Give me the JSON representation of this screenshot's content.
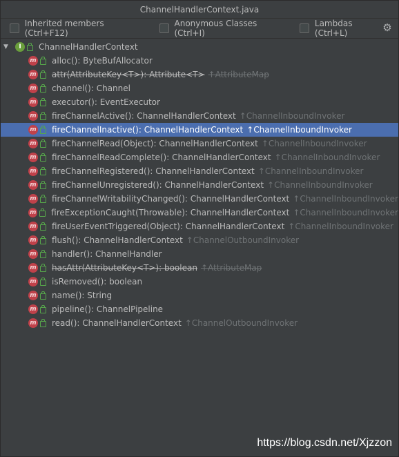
{
  "window": {
    "title": "ChannelHandlerContext.java"
  },
  "toolbar": {
    "inherited_label": "Inherited members (Ctrl+F12)",
    "anonymous_label": "Anonymous Classes (Ctrl+I)",
    "lambdas_label": "Lambdas (Ctrl+L)",
    "settings_icon": "gear-icon"
  },
  "tree": {
    "root": {
      "label": "ChannelHandlerContext",
      "icon": "interface-icon",
      "expanded": true
    },
    "members": [
      {
        "text": "alloc(): ByteBufAllocator",
        "inherit": "",
        "deprecated": false
      },
      {
        "text": "attr(AttributeKey<T>): Attribute<T>",
        "inherit": "↑AttributeMap",
        "deprecated": true
      },
      {
        "text": "channel(): Channel",
        "inherit": "",
        "deprecated": false
      },
      {
        "text": "executor(): EventExecutor",
        "inherit": "",
        "deprecated": false
      },
      {
        "text": "fireChannelActive(): ChannelHandlerContext",
        "inherit": "↑ChannelInboundInvoker",
        "deprecated": false
      },
      {
        "text": "fireChannelInactive(): ChannelHandlerContext",
        "inherit": "↑ChannelInboundInvoker",
        "deprecated": false,
        "selected": true
      },
      {
        "text": "fireChannelRead(Object): ChannelHandlerContext",
        "inherit": "↑ChannelInboundInvoker",
        "deprecated": false
      },
      {
        "text": "fireChannelReadComplete(): ChannelHandlerContext",
        "inherit": "↑ChannelInboundInvoker",
        "deprecated": false
      },
      {
        "text": "fireChannelRegistered(): ChannelHandlerContext",
        "inherit": "↑ChannelInboundInvoker",
        "deprecated": false
      },
      {
        "text": "fireChannelUnregistered(): ChannelHandlerContext",
        "inherit": "↑ChannelInboundInvoker",
        "deprecated": false
      },
      {
        "text": "fireChannelWritabilityChanged(): ChannelHandlerContext",
        "inherit": "↑ChannelInboundInvoker",
        "deprecated": false
      },
      {
        "text": "fireExceptionCaught(Throwable): ChannelHandlerContext",
        "inherit": "↑ChannelInboundInvoker",
        "deprecated": false
      },
      {
        "text": "fireUserEventTriggered(Object): ChannelHandlerContext",
        "inherit": "↑ChannelInboundInvoker",
        "deprecated": false
      },
      {
        "text": "flush(): ChannelHandlerContext",
        "inherit": "↑ChannelOutboundInvoker",
        "deprecated": false
      },
      {
        "text": "handler(): ChannelHandler",
        "inherit": "",
        "deprecated": false
      },
      {
        "text": "hasAttr(AttributeKey<T>): boolean",
        "inherit": "↑AttributeMap",
        "deprecated": true
      },
      {
        "text": "isRemoved(): boolean",
        "inherit": "",
        "deprecated": false
      },
      {
        "text": "name(): String",
        "inherit": "",
        "deprecated": false
      },
      {
        "text": "pipeline(): ChannelPipeline",
        "inherit": "",
        "deprecated": false
      },
      {
        "text": "read(): ChannelHandlerContext",
        "inherit": "↑ChannelOutboundInvoker",
        "deprecated": false
      }
    ]
  },
  "watermark": "https://blog.csdn.net/Xjzzon",
  "colors": {
    "background": "#3c3f41",
    "selection": "#4b6eaf",
    "method_icon": "#c0414a",
    "interface_icon": "#6a9e3c",
    "inherit_text": "#6f7375"
  }
}
